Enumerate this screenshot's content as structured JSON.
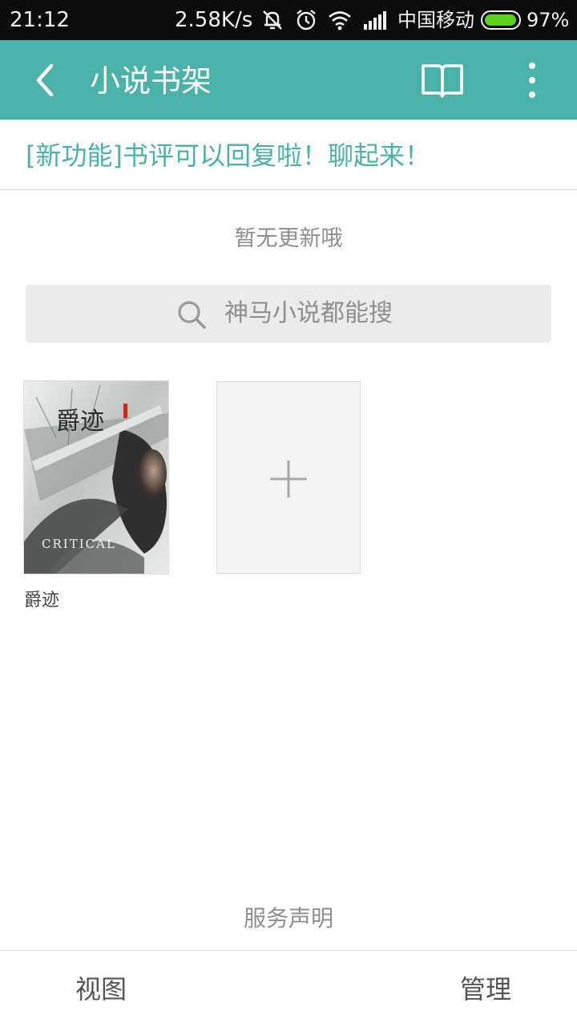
{
  "status_bar": {
    "time": "21:12",
    "speed": "2.58K/s",
    "carrier": "中国移动",
    "battery": "97%",
    "battery_level": 0.97,
    "icons": [
      "mute-vibrate-icon",
      "alarm-icon",
      "wifi-icon",
      "signal-icon"
    ]
  },
  "header": {
    "title": "小说书架",
    "icons": [
      "back-icon",
      "open-book-icon",
      "more-vert-icon"
    ],
    "accent_color": "#4ab2a8"
  },
  "announcement": "[新功能]书评可以回复啦！聊起来！",
  "no_update_text": "暂无更新哦",
  "search": {
    "placeholder": "神马小说都能搜",
    "icon": "search-icon"
  },
  "books": [
    {
      "title": "爵迹",
      "cover_text": "爵迹",
      "cover_subtext": "CRITICAL"
    }
  ],
  "add_book_icon": "plus-icon",
  "footer_link": "服务声明",
  "bottom_bar": {
    "left_label": "视图",
    "right_label": "管理"
  }
}
